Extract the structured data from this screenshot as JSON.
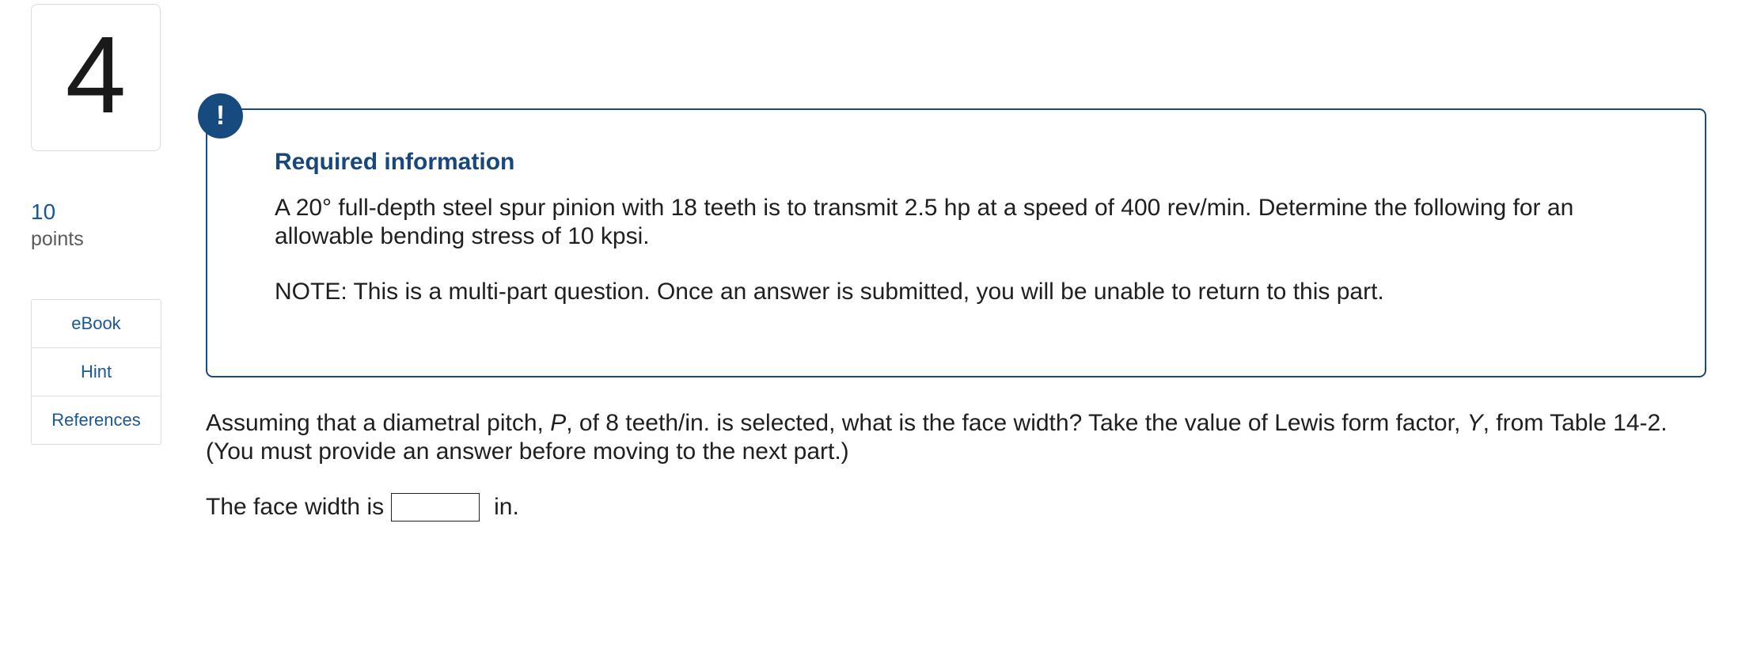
{
  "question_number": "4",
  "points": {
    "value": "10",
    "label": "points"
  },
  "tools": [
    {
      "label": "eBook"
    },
    {
      "label": "Hint"
    },
    {
      "label": "References"
    }
  ],
  "alert": {
    "icon": "exclamation-icon",
    "glyph": "!",
    "title": "Required information",
    "body": "A 20° full-depth steel spur pinion with 18 teeth is to transmit 2.5 hp at a speed of 400 rev/min. Determine the following for an allowable bending stress of 10 kpsi.",
    "note": "NOTE: This is a multi-part question. Once an answer is submitted, you will be unable to return to this part."
  },
  "question": {
    "part1": "Assuming that a diametral pitch, ",
    "var1": "P",
    "part2": ", of 8 teeth/in. is selected, what is the face width? Take the value of Lewis form factor, ",
    "var2": "Y",
    "part3": ", from Table 14-2. (You must provide an answer before moving to the next part.)"
  },
  "answer": {
    "prefix": "The face width is",
    "value": "",
    "unit": "in."
  },
  "colors": {
    "accent": "#1a5799",
    "panel_border": "#1a4a7e",
    "badge": "#174b80"
  }
}
